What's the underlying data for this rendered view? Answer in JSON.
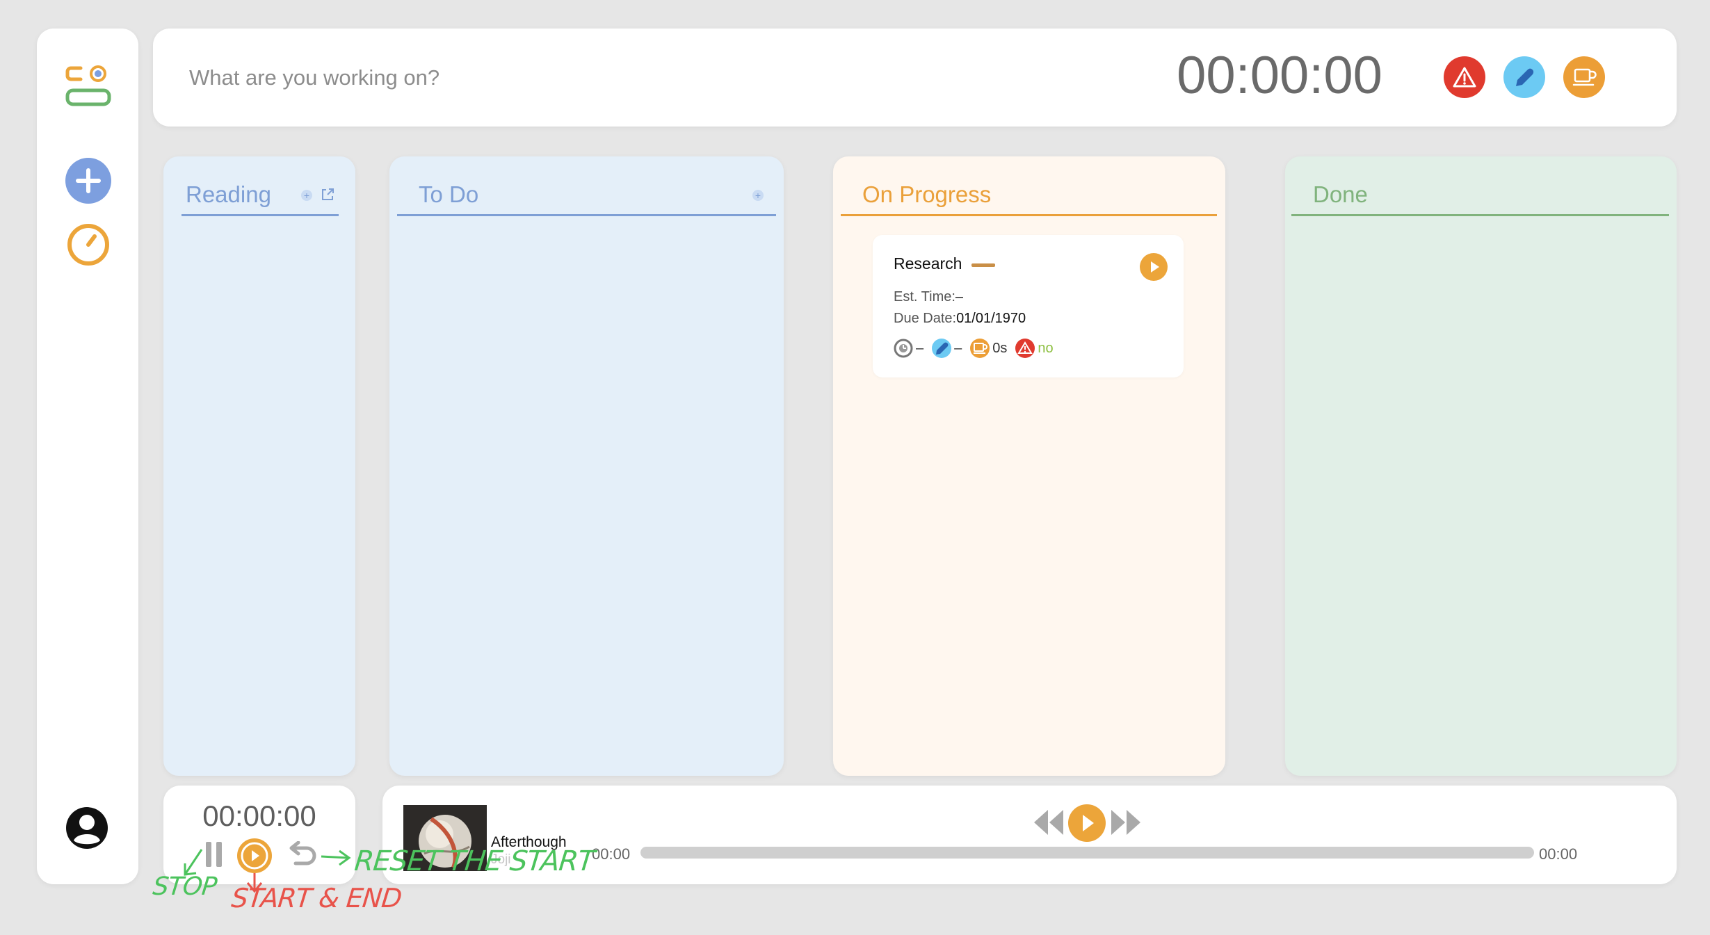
{
  "sidebar": {
    "items": [
      {
        "name": "logo",
        "icon": "kanban-logo-icon"
      },
      {
        "name": "add",
        "icon": "plus-circle-icon"
      },
      {
        "name": "timer",
        "icon": "stopwatch-icon"
      },
      {
        "name": "profile",
        "icon": "user-circle-icon"
      }
    ]
  },
  "topbar": {
    "task_placeholder": "What are you working on?",
    "timer": "00:00:00",
    "buttons": [
      {
        "name": "interruption",
        "icon": "warning-icon",
        "color": "#e03a2e"
      },
      {
        "name": "focus",
        "icon": "pen-icon",
        "color": "#6ccaf3"
      },
      {
        "name": "break",
        "icon": "coffee-cup-icon",
        "color": "#ec9e36"
      }
    ]
  },
  "columns": {
    "reading": {
      "title": "Reading",
      "color": "#7e9fd5"
    },
    "todo": {
      "title": "To Do",
      "color": "#7e9fd5"
    },
    "progress": {
      "title": "On Progress",
      "color": "#eaa03a"
    },
    "done": {
      "title": "Done",
      "color": "#80b37d"
    }
  },
  "task_card": {
    "title": "Research",
    "est_label": "Est. Time:",
    "est_value": "–",
    "due_label": "Due Date:",
    "due_value": "01/01/1970",
    "meta": {
      "clock_value": "–",
      "pen_value": "–",
      "break_value": "0s",
      "interrupt_value": "no"
    }
  },
  "mini_timer": {
    "time": "00:00:00"
  },
  "player": {
    "song": "Afterthough",
    "artist": "Joji",
    "time_current": "00:00",
    "time_total": "00:00",
    "progress": 0
  },
  "annotations": {
    "stop": "STOP",
    "start_end": "START & END",
    "reset": "RESET THE START"
  },
  "colors": {
    "accent_orange": "#eca53a",
    "accent_blue": "#7d9fdf",
    "alert_red": "#e03a2e",
    "pen_blue": "#6ccaf3",
    "annotation_green": "#4cc35d",
    "annotation_red": "#e8534a"
  }
}
